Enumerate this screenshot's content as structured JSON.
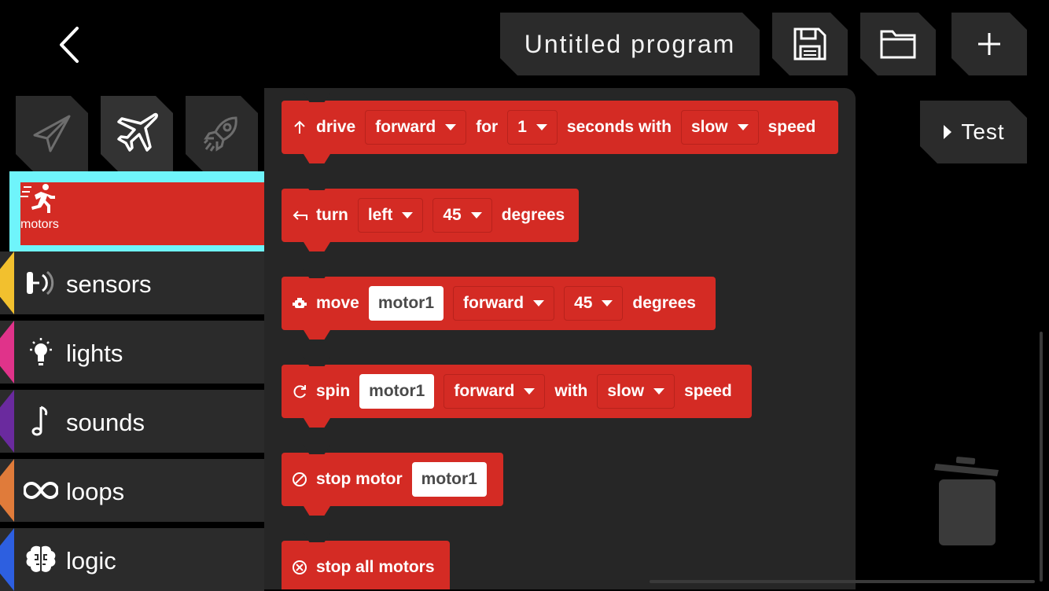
{
  "header": {
    "program_title": "Untitled program",
    "icons": {
      "back": "chevron-left-icon",
      "save": "save-icon",
      "open": "folder-icon",
      "add": "plus-icon"
    }
  },
  "test_button": {
    "label": "Test",
    "icon": "play-icon"
  },
  "robot_tabs": [
    {
      "icon": "paper-plane-icon",
      "selected": false
    },
    {
      "icon": "airplane-icon",
      "selected": true
    },
    {
      "icon": "rocket-icon",
      "selected": false
    }
  ],
  "categories": [
    {
      "label": "motors",
      "icon": "running-person-icon",
      "color": "#d42b24",
      "selected": true
    },
    {
      "label": "sensors",
      "icon": "sensor-icon",
      "color": "#f2c02e"
    },
    {
      "label": "lights",
      "icon": "light-bulb-icon",
      "color": "#e0338a"
    },
    {
      "label": "sounds",
      "icon": "music-note-icon",
      "color": "#6a2a9e"
    },
    {
      "label": "loops",
      "icon": "infinity-loop-icon",
      "color": "#e07b3a"
    },
    {
      "label": "logic",
      "icon": "brain-icon",
      "color": "#2d5fe0"
    }
  ],
  "blocks": {
    "drive": {
      "icon": "arrow-up-icon",
      "keyword": "drive",
      "direction": "forward",
      "for_text": "for",
      "duration": "1",
      "seconds_text": "seconds with",
      "speed": "slow",
      "speed_text": "speed"
    },
    "turn": {
      "icon": "turn-left-arrow-icon",
      "keyword": "turn",
      "direction": "left",
      "degrees": "45",
      "degrees_text": "degrees"
    },
    "move": {
      "icon": "motor-icon",
      "keyword": "move",
      "motor": "motor1",
      "direction": "forward",
      "degrees": "45",
      "degrees_text": "degrees"
    },
    "spin": {
      "icon": "rotate-icon",
      "keyword": "spin",
      "motor": "motor1",
      "direction": "forward",
      "with_text": "with",
      "speed": "slow",
      "speed_text": "speed"
    },
    "stop_motor": {
      "icon": "stop-circle-icon",
      "keyword": "stop motor",
      "motor": "motor1"
    },
    "stop_all": {
      "icon": "stop-x-circle-icon",
      "keyword": "stop all motors"
    }
  },
  "trash": {
    "icon": "trash-icon"
  }
}
